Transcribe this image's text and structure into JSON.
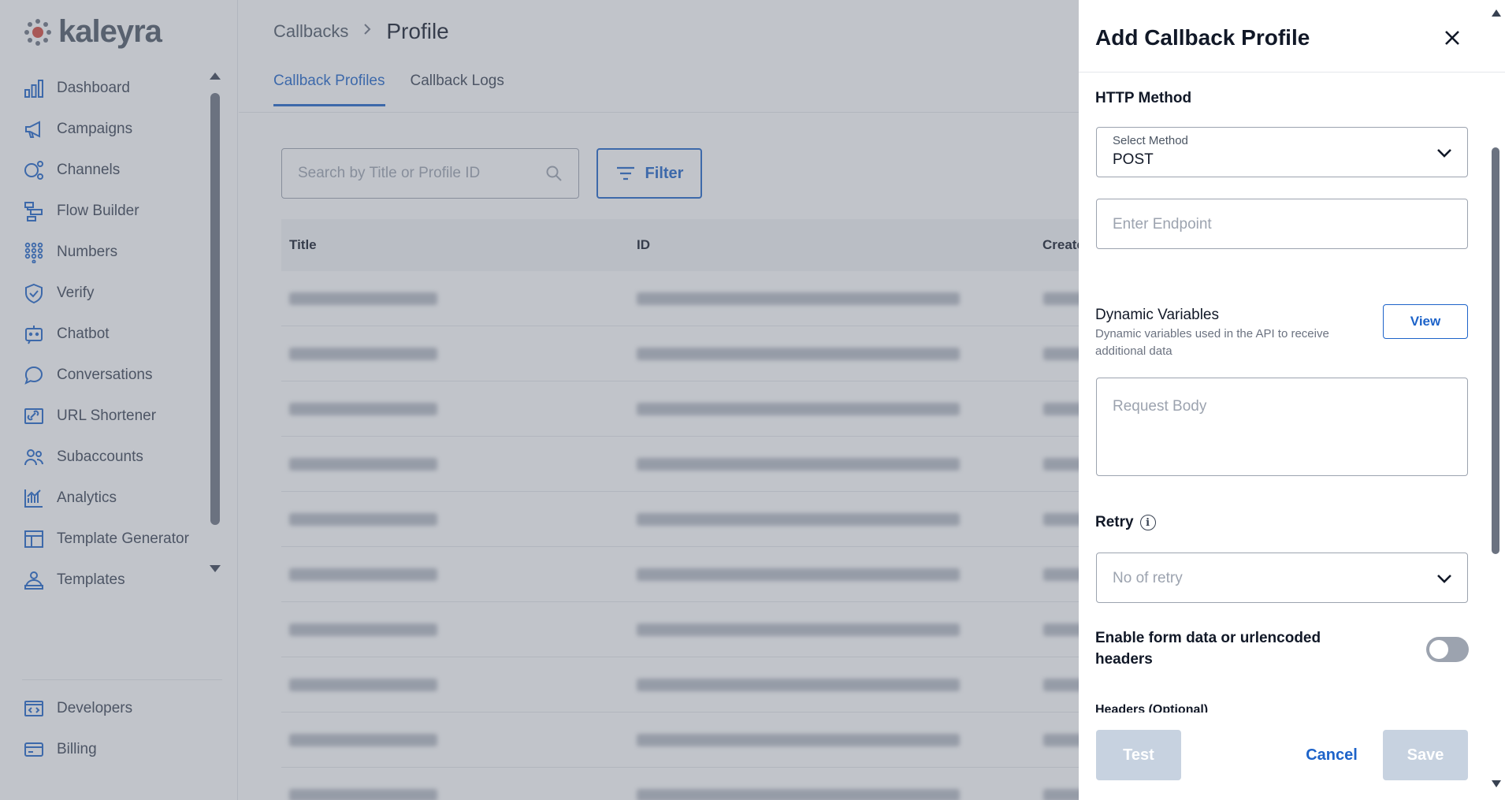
{
  "brand": {
    "logo_text": "kaleyra",
    "accent": "#1d63c9"
  },
  "sidebar": {
    "items": [
      {
        "label": "Dashboard",
        "icon": "bar-chart-icon"
      },
      {
        "label": "Campaigns",
        "icon": "megaphone-icon"
      },
      {
        "label": "Channels",
        "icon": "channels-icon"
      },
      {
        "label": "Flow Builder",
        "icon": "flow-icon"
      },
      {
        "label": "Numbers",
        "icon": "dialpad-icon"
      },
      {
        "label": "Verify",
        "icon": "shield-check-icon"
      },
      {
        "label": "Chatbot",
        "icon": "chatbot-icon"
      },
      {
        "label": "Conversations",
        "icon": "chat-bubble-icon"
      },
      {
        "label": "URL Shortener",
        "icon": "link-icon"
      },
      {
        "label": "Subaccounts",
        "icon": "users-icon"
      },
      {
        "label": "Analytics",
        "icon": "analytics-icon"
      },
      {
        "label": "Template Generator",
        "icon": "layout-icon"
      },
      {
        "label": "Templates",
        "icon": "templates-icon"
      }
    ],
    "bottom_items": [
      {
        "label": "Developers",
        "icon": "code-icon"
      },
      {
        "label": "Billing",
        "icon": "credit-card-icon"
      }
    ]
  },
  "breadcrumb": {
    "parent": "Callbacks",
    "separator": ">",
    "current": "Profile"
  },
  "tabs": [
    {
      "label": "Callback Profiles",
      "active": true
    },
    {
      "label": "Callback Logs",
      "active": false
    }
  ],
  "search": {
    "placeholder": "Search by Title or Profile ID"
  },
  "filter_button": {
    "label": "Filter"
  },
  "table": {
    "headers": {
      "title": "Title",
      "id": "ID",
      "created": "Create"
    },
    "row_count": 10
  },
  "drawer": {
    "title": "Add Callback Profile",
    "http_method": {
      "section_label": "HTTP Method",
      "select_label": "Select Method",
      "value": "POST"
    },
    "endpoint": {
      "placeholder": "Enter Endpoint"
    },
    "dynamic_variables": {
      "label": "Dynamic Variables",
      "description": "Dynamic variables used in the API to receive additional data",
      "view_button": "View"
    },
    "request_body": {
      "placeholder": "Request Body"
    },
    "retry": {
      "label": "Retry",
      "placeholder": "No of retry"
    },
    "form_data": {
      "label": "Enable form data or urlencoded headers",
      "enabled": false
    },
    "headers": {
      "label": "Headers (Optional)"
    },
    "footer": {
      "test": "Test",
      "cancel": "Cancel",
      "save": "Save"
    }
  }
}
